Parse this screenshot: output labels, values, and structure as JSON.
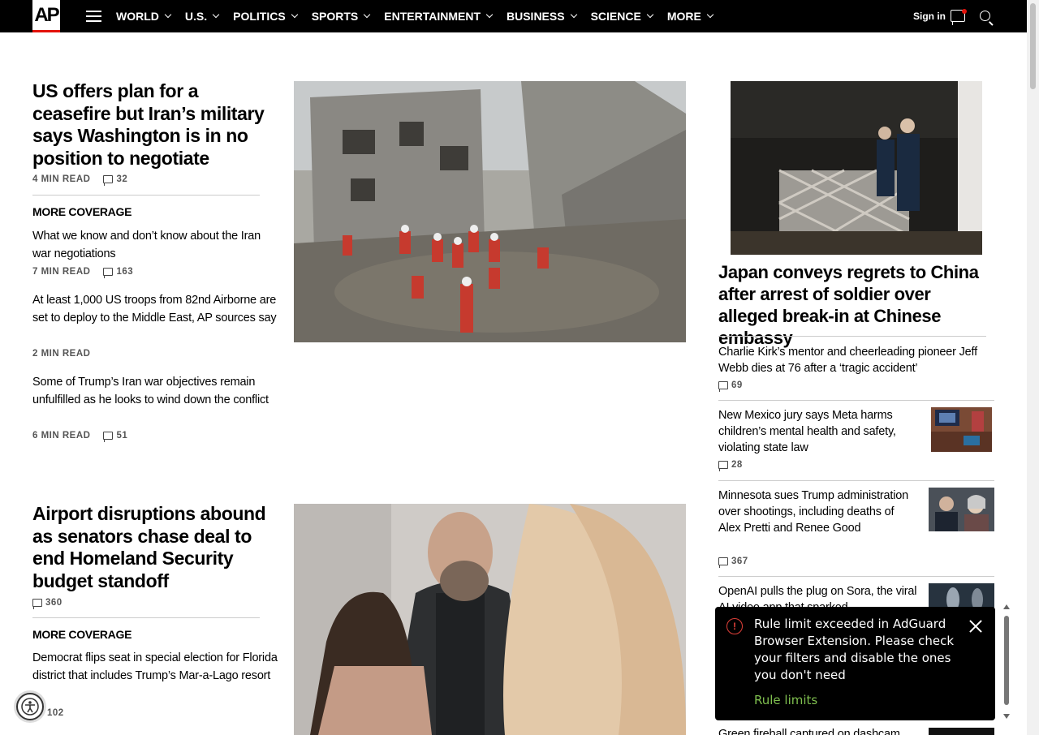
{
  "nav": {
    "logo": "AP",
    "items": [
      {
        "label": "WORLD"
      },
      {
        "label": "U.S."
      },
      {
        "label": "POLITICS"
      },
      {
        "label": "SPORTS"
      },
      {
        "label": "ENTERTAINMENT"
      },
      {
        "label": "BUSINESS"
      },
      {
        "label": "SCIENCE"
      },
      {
        "label": "MORE"
      }
    ],
    "signin": "Sign in"
  },
  "story1": {
    "headline": "US offers plan for a ceasefire but Iran’s military says Washington is in no position to negotiate",
    "read": "4 MIN READ",
    "comments": "32",
    "more_coverage": "MORE COVERAGE",
    "subs": [
      {
        "title": "What we know and don’t know about the Iran war negotiations",
        "read": "7 MIN READ",
        "comments": "163"
      },
      {
        "title": "At least 1,000 US troops from 82nd Airborne are set to deploy to the Middle East, AP sources say",
        "read": "2 MIN READ",
        "comments": ""
      },
      {
        "title": "Some of Trump’s Iran war objectives remain unfulfilled as he looks to wind down the conflict",
        "read": "6 MIN READ",
        "comments": "51"
      }
    ]
  },
  "story2": {
    "headline": "Airport disruptions abound as senators chase deal to end Homeland Security budget standoff",
    "comments": "360",
    "more_coverage": "MORE COVERAGE",
    "subs": [
      {
        "title": "Democrat flips seat in special election for Florida district that includes Trump’s Mar-a-Lago resort",
        "comments": "102"
      }
    ]
  },
  "right": {
    "headline": "Japan conveys regrets to China after arrest of soldier over alleged break-in at Chinese embassy",
    "items": [
      {
        "title": "Charlie Kirk’s mentor and cheerleading pioneer Jeff Webb dies at 76 after a ‘tragic accident’",
        "comments": "69"
      },
      {
        "title": "New Mexico jury says Meta harms children’s mental health and safety, violating state law",
        "comments": "28"
      },
      {
        "title": "Minnesota sues Trump administration over shootings, including deaths of Alex Pretti and Renee Good",
        "comments": "367"
      },
      {
        "title": "OpenAI pulls the plug on Sora, the viral AI video app that sparked",
        "comments": ""
      },
      {
        "title": "Green fireball captured on dashcam",
        "comments": ""
      }
    ]
  },
  "toast": {
    "message": "Rule limit exceeded in AdGuard Browser Extension. Please check your filters and disable the ones you don't need",
    "link": "Rule limits"
  },
  "colors": {
    "brand_red": "#e3120b",
    "toast_link": "#7fbf4f",
    "nav_bg": "#000000"
  }
}
